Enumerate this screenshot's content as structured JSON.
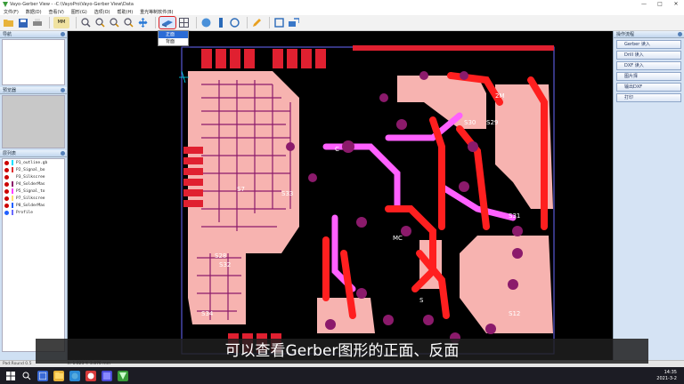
{
  "window": {
    "title": "Vayo-Gerber View -  -C:\\VayoPro\\Vayo-Gerber View\\Data",
    "controls": {
      "minimize": "—",
      "maximize": "□",
      "close": "✕"
    }
  },
  "menu": [
    "文件(F)",
    "数据(D)",
    "查看(V)",
    "图形(G)",
    "选项(O)",
    "帮助(H)",
    "重光等制软件(B)"
  ],
  "toolbar": {
    "unit_label": "MM"
  },
  "flip_menu": {
    "items": [
      "正面",
      "背面"
    ],
    "selected_index": 0
  },
  "left_panel": {
    "sections": {
      "thumbnail": "导航",
      "preview": "预览器",
      "layers": "层列表"
    },
    "layers": [
      {
        "name": "P1_outline.gb",
        "color": "#00e0ff"
      },
      {
        "name": "P2_Signal_bo",
        "color": "#e03030"
      },
      {
        "name": "P3_Silkscree",
        "color": "#ffffff"
      },
      {
        "name": "P4_SolderMas",
        "color": "#8b1a6b"
      },
      {
        "name": "P5_Signal_to",
        "color": "#ff40ff"
      },
      {
        "name": "P7_Silkscree",
        "color": "#ffe070"
      },
      {
        "name": "P8_SolderMas",
        "color": "#2060ff"
      },
      {
        "name": "Profile",
        "color": "#6a6aff"
      }
    ]
  },
  "right_panel": {
    "header": "操作流程",
    "buttons": [
      "Gerber 读入",
      "Drill 读入",
      "DXF 读入",
      "图片择",
      "输出DXF",
      "打印"
    ]
  },
  "canvas": {
    "labels": [
      "S7",
      "S33",
      "S28",
      "S32",
      "S34",
      "S12",
      "S29",
      "S30",
      "S31",
      "2M",
      "MC",
      "C",
      "S"
    ],
    "colors": {
      "copper_pad": "#f7b3b0",
      "signal": "#ff1f1f",
      "mask": "#8b1a6b",
      "top": "#ff60ff",
      "outline": "#6a6aff"
    }
  },
  "status_bar": {
    "left": "Pad:Round 0.5",
    "coord": "X: 1.023  Y: 3.876 mm"
  },
  "taskbar": {
    "time": "14:35",
    "date": "2021-3-2"
  },
  "subtitle": "可以查看Gerber图形的正面、反面"
}
